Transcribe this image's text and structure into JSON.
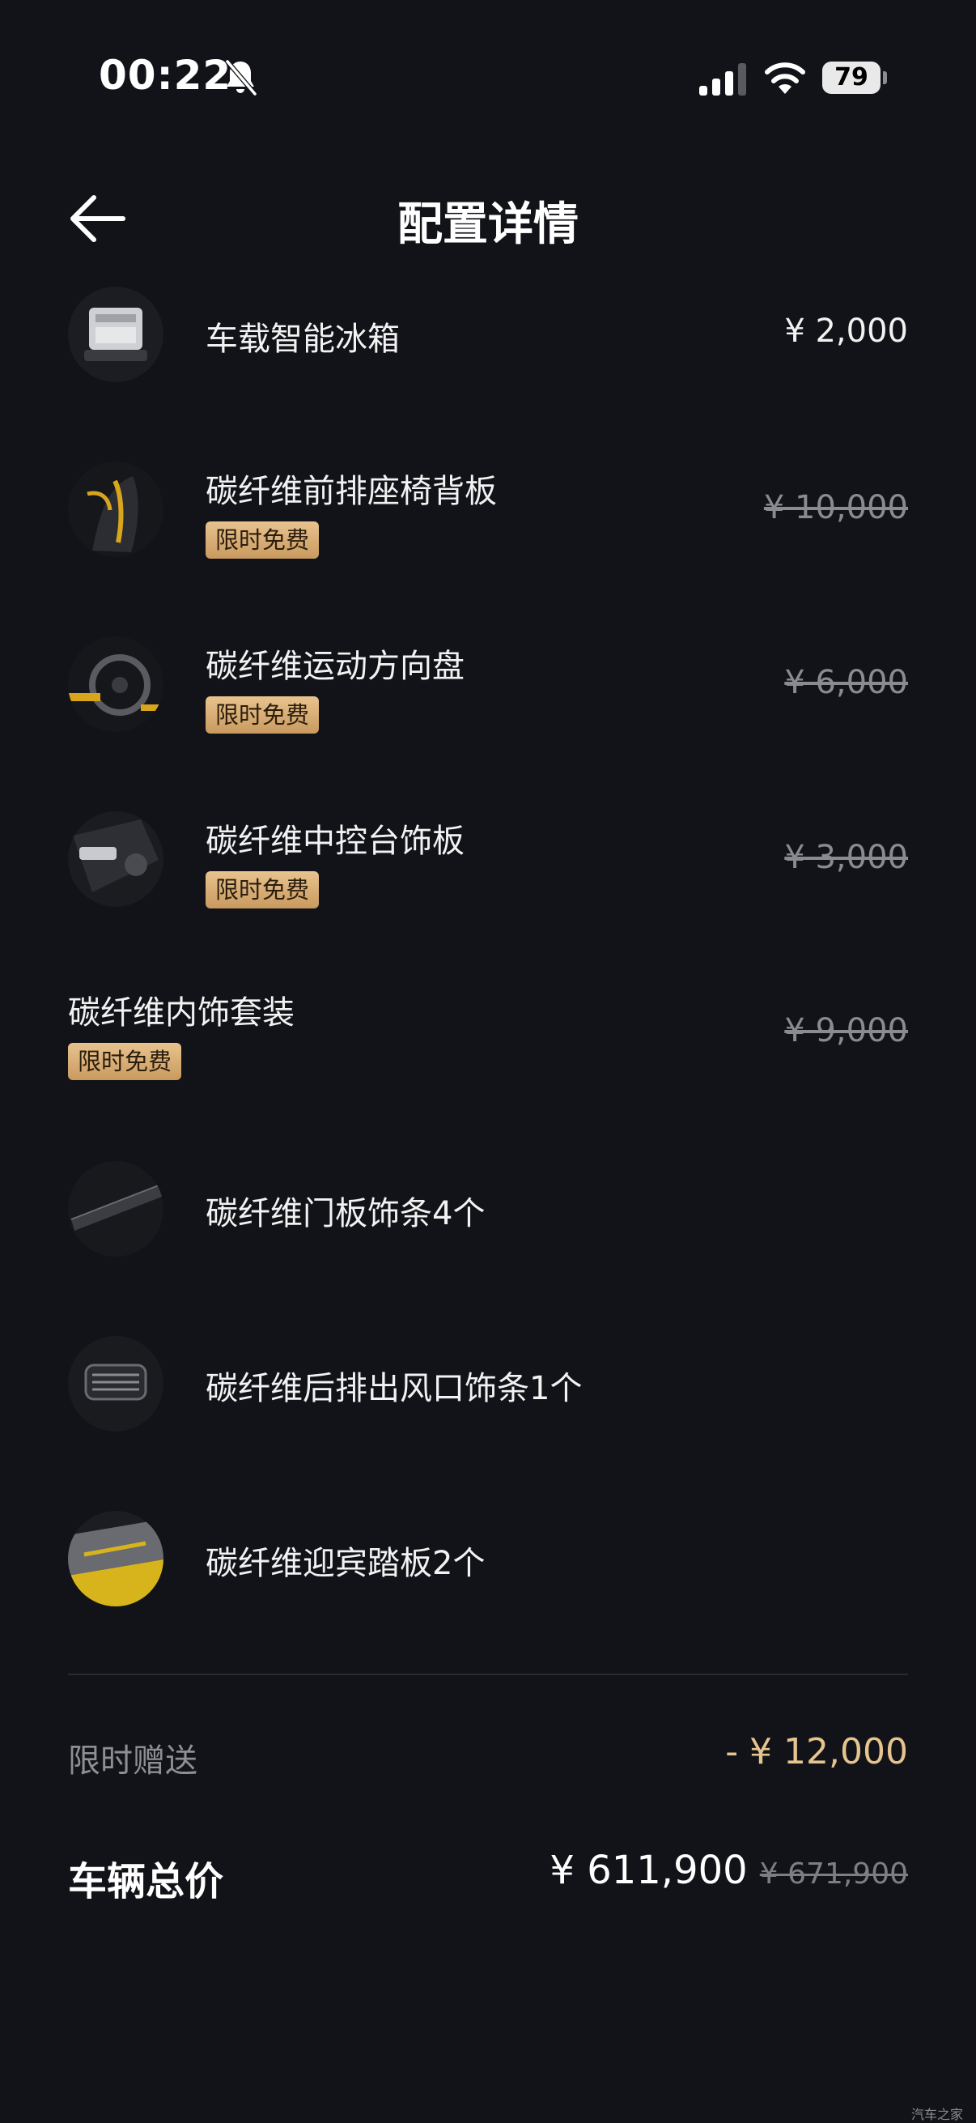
{
  "status_bar": {
    "time": "00:22",
    "battery": "79",
    "icons": [
      "bell-slash-icon",
      "signal-icon",
      "wifi-icon",
      "battery-icon"
    ]
  },
  "header": {
    "title": "配置详情",
    "back_icon": "arrow-left-icon"
  },
  "items": [
    {
      "name": "车载智能冰箱",
      "price": "¥ 2,000",
      "badge": "",
      "price_struck": false
    },
    {
      "name": "碳纤维前排座椅背板",
      "price": "¥ 10,000",
      "badge": "限时免费",
      "price_struck": true
    },
    {
      "name": "碳纤维运动方向盘",
      "price": "¥ 6,000",
      "badge": "限时免费",
      "price_struck": true
    },
    {
      "name": "碳纤维中控台饰板",
      "price": "¥ 3,000",
      "badge": "限时免费",
      "price_struck": true
    },
    {
      "name": "碳纤维内饰套装",
      "price": "¥ 9,000",
      "badge": "限时免费",
      "price_struck": true
    },
    {
      "name": "碳纤维门板饰条4个"
    },
    {
      "name": "碳纤维后排出风口饰条1个"
    },
    {
      "name": "碳纤维迎宾踏板2个"
    }
  ],
  "summary": {
    "gift_label": "限时赠送",
    "gift_value": "- ¥ 12,000",
    "total_label": "车辆总价",
    "total_price": "¥ 611,900",
    "total_original": "¥ 671,900"
  },
  "watermark": "汽车之家",
  "colors": {
    "background": "#121318",
    "badge_gold": "#d9b07a",
    "gift_gold": "#e5c48f",
    "muted_text": "#8a8b90"
  }
}
